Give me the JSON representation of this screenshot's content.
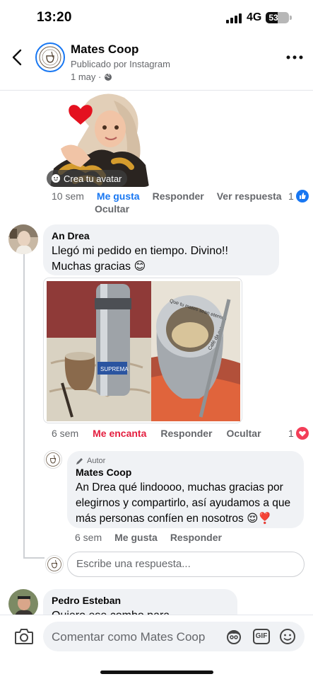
{
  "status": {
    "time": "13:20",
    "network": "4G",
    "battery": "53"
  },
  "header": {
    "title": "Mates Coop",
    "subtitle": "Publicado por Instagram",
    "date": "1 may ·"
  },
  "comment1": {
    "avatar_badge": "Crea tu avatar",
    "time": "10 sem",
    "like": "Me gusta",
    "reply": "Responder",
    "see_reply": "Ver respuesta",
    "hide": "Ocultar",
    "reaction_count": "1"
  },
  "comment2": {
    "author": "An Drea",
    "text": "Llegó mi pedido en tiempo. Divino!! Muchas gracias 😊",
    "time": "6 sem",
    "love": "Me encanta",
    "reply": "Responder",
    "hide": "Ocultar",
    "reaction_count": "1",
    "photo_mug_text": "Que tu mates sean eternos",
    "photo_mug_text2": "Café da gol",
    "photo_label": "SUPREMA"
  },
  "reply1": {
    "role": "Autor",
    "author": "Mates Coop",
    "text": "An Drea qué lindoooo, muchas gracias por elegirnos y compartirlo, así ayudamos a que más personas  confíen en nosotros 😌❣️",
    "time": "6 sem",
    "like": "Me gusta",
    "reply": "Responder"
  },
  "reply_input": {
    "placeholder": "Escribe una respuesta..."
  },
  "comment3": {
    "author": "Pedro Esteban",
    "text": "Quiero ese combo para reventa!???"
  },
  "composer": {
    "placeholder": "Comentar como Mates Coop",
    "gif": "GIF"
  },
  "colors": {
    "accent": "#1877f2",
    "love": "#e41e3f",
    "bubble": "#f0f2f5"
  }
}
